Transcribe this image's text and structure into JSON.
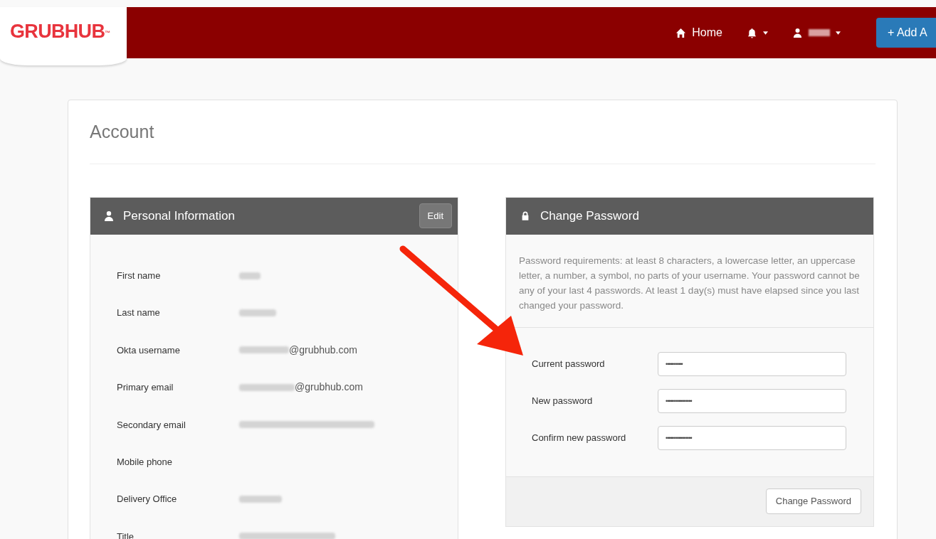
{
  "header": {
    "logo": "GRUBHUB",
    "logo_mark": "™",
    "nav": [
      {
        "kind": "link",
        "label": "Home"
      },
      {
        "kind": "bell"
      },
      {
        "kind": "user",
        "redacted": true
      }
    ],
    "add_button": "+ Add A"
  },
  "page_title": "Account",
  "personal": {
    "title": "Personal Information",
    "edit_button": "Edit",
    "fields": [
      {
        "label": "First name",
        "redacted": true
      },
      {
        "label": "Last name",
        "redacted": true
      },
      {
        "label": "Okta username",
        "redacted": true,
        "value": "@grubhub.com"
      },
      {
        "label": "Primary email",
        "redacted": true,
        "value": "@grubhub.com"
      },
      {
        "label": "Secondary email",
        "redacted": true
      },
      {
        "label": "Mobile phone",
        "redacted": false
      },
      {
        "label": "Delivery Office",
        "redacted": true
      },
      {
        "label": "Title",
        "redacted": true
      }
    ]
  },
  "password": {
    "title": "Change Password",
    "requirements": "Password requirements: at least 8 characters, a lowercase letter, an uppercase letter, a number, a symbol, no parts of your username. Your password cannot be any of your last 4 passwords. At least 1 day(s) must have elapsed since you last changed your password.",
    "fields": [
      {
        "label": "Current password",
        "value": "•••••••••••"
      },
      {
        "label": "New password",
        "value": "•••••••••••••••••"
      },
      {
        "label": "Confirm new password",
        "value": "•••••••••••••••••"
      }
    ],
    "submit_button": "Change Password"
  }
}
